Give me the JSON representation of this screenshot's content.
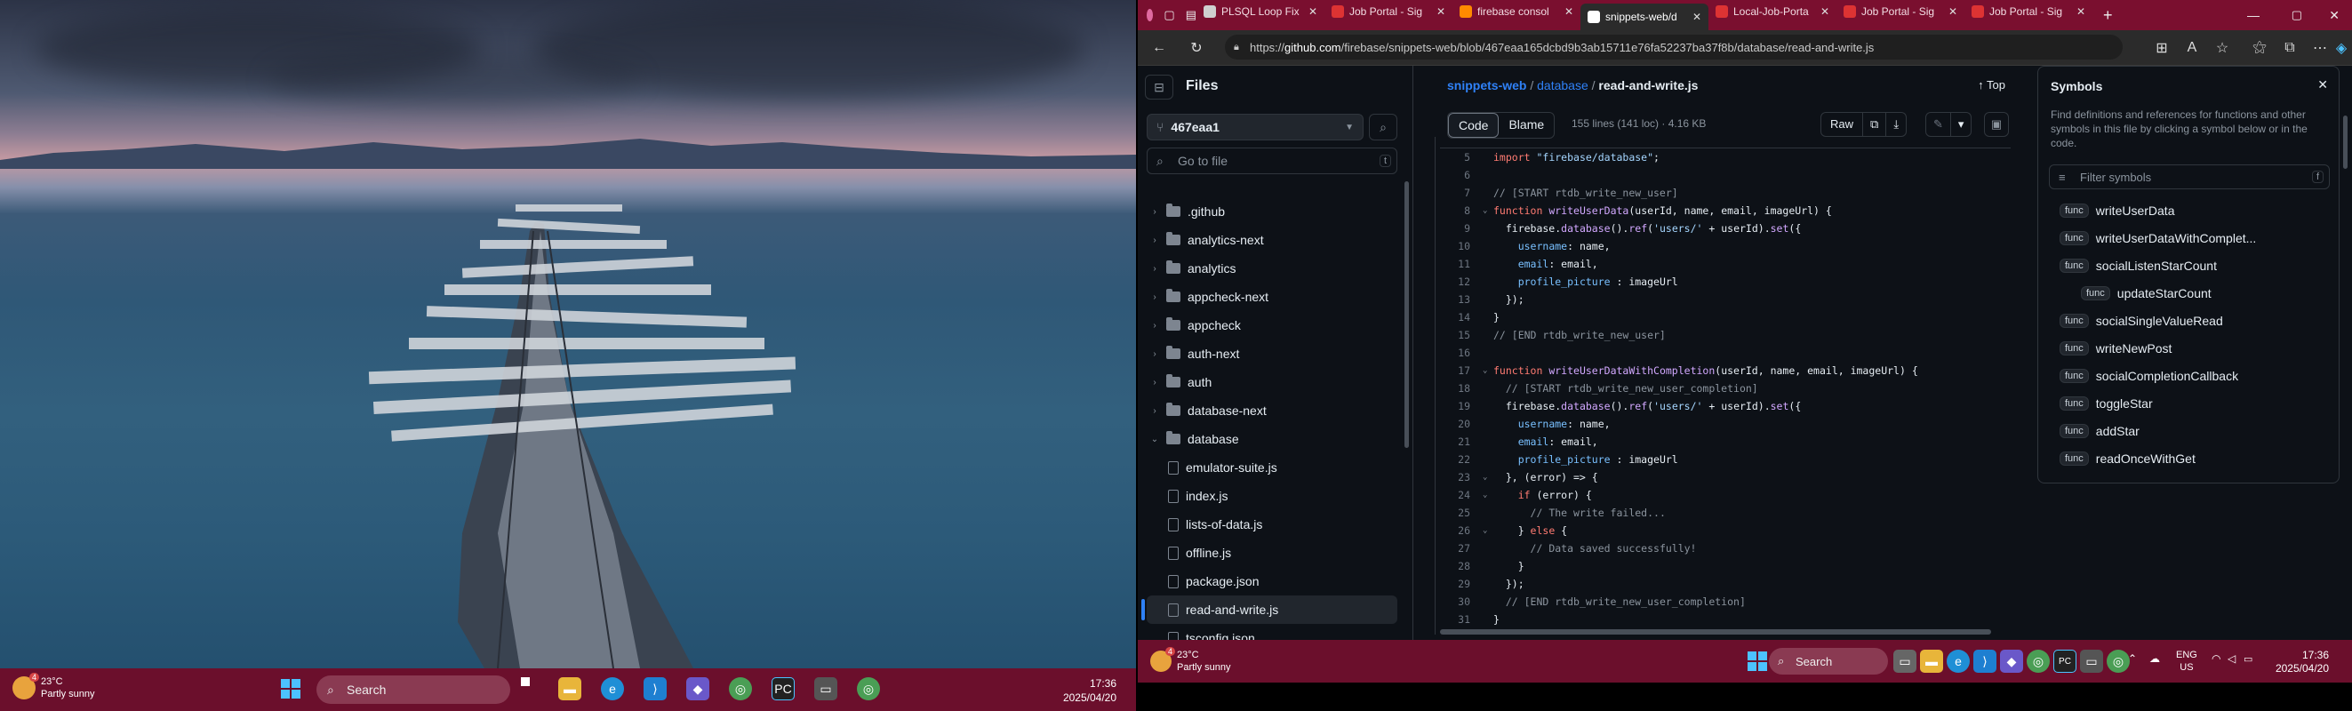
{
  "left_taskbar": {
    "weather_temp": "23°C",
    "weather_desc": "Partly sunny",
    "weather_badge": "4",
    "search": "Search",
    "time": "17:36",
    "date": "2025/04/20"
  },
  "browser": {
    "tabs": [
      {
        "label": "PLSQL Loop Fix",
        "fav": "#cfcfcf"
      },
      {
        "label": "Job Portal - Sig",
        "fav": "#d33"
      },
      {
        "label": "firebase consol",
        "fav": "#ff8a00"
      },
      {
        "label": "snippets-web/d",
        "fav": "#ffffff"
      },
      {
        "label": "Local-Job-Porta",
        "fav": "#d33"
      },
      {
        "label": "Job Portal - Sig",
        "fav": "#d33"
      },
      {
        "label": "Job Portal - Sig",
        "fav": "#d33"
      }
    ],
    "url_prefix": "https://",
    "url_host": "github.com",
    "url_path": "/firebase/snippets-web/blob/467eaa165dcbd9b3ab15711e76fa52237ba37f8b/database/read-and-write.js"
  },
  "files": {
    "title": "Files",
    "branch": "467eaa1",
    "goto_placeholder": "Go to file",
    "goto_key": "t",
    "items": [
      {
        "label": ".github",
        "kind": "folder",
        "open": false
      },
      {
        "label": "analytics-next",
        "kind": "folder",
        "open": false
      },
      {
        "label": "analytics",
        "kind": "folder",
        "open": false
      },
      {
        "label": "appcheck-next",
        "kind": "folder",
        "open": false
      },
      {
        "label": "appcheck",
        "kind": "folder",
        "open": false
      },
      {
        "label": "auth-next",
        "kind": "folder",
        "open": false
      },
      {
        "label": "auth",
        "kind": "folder",
        "open": false
      },
      {
        "label": "database-next",
        "kind": "folder",
        "open": false
      },
      {
        "label": "database",
        "kind": "folder",
        "open": true
      },
      {
        "label": "emulator-suite.js",
        "kind": "file"
      },
      {
        "label": "index.js",
        "kind": "file"
      },
      {
        "label": "lists-of-data.js",
        "kind": "file"
      },
      {
        "label": "offline.js",
        "kind": "file"
      },
      {
        "label": "package.json",
        "kind": "file"
      },
      {
        "label": "read-and-write.js",
        "kind": "file",
        "selected": true
      },
      {
        "label": "tsconfig.json",
        "kind": "file"
      }
    ]
  },
  "code": {
    "repo": "snippets-web",
    "dir": "database",
    "file": "read-and-write.js",
    "top": "Top",
    "tab_code": "Code",
    "tab_blame": "Blame",
    "meta": "155 lines (141 loc) · 4.16 KB",
    "raw": "Raw",
    "lines": [
      {
        "n": "5",
        "html": "<span class='kw'>import</span> <span class='st'>\"firebase/database\"</span>;"
      },
      {
        "n": "6",
        "html": ""
      },
      {
        "n": "7",
        "html": "<span class='cm'>// [START rtdb_write_new_user]</span>"
      },
      {
        "n": "8",
        "g": "⌄",
        "html": "<span class='kw'>function</span> <span class='fn'>writeUserData</span>(userId, name, email, imageUrl) {"
      },
      {
        "n": "9",
        "html": "  firebase.<span class='fn'>database</span>().<span class='fn'>ref</span>(<span class='st'>'users/'</span> + userId).<span class='fn'>set</span>({"
      },
      {
        "n": "10",
        "html": "    <span class='pr'>username</span>: name,"
      },
      {
        "n": "11",
        "html": "    <span class='pr'>email</span>: email,"
      },
      {
        "n": "12",
        "html": "    <span class='pr'>profile_picture</span> : imageUrl"
      },
      {
        "n": "13",
        "html": "  });"
      },
      {
        "n": "14",
        "html": "}"
      },
      {
        "n": "15",
        "html": "<span class='cm'>// [END rtdb_write_new_user]</span>"
      },
      {
        "n": "16",
        "html": ""
      },
      {
        "n": "17",
        "g": "⌄",
        "html": "<span class='kw'>function</span> <span class='fn'>writeUserDataWithCompletion</span>(userId, name, email, imageUrl) {"
      },
      {
        "n": "18",
        "html": "  <span class='cm'>// [START rtdb_write_new_user_completion]</span>"
      },
      {
        "n": "19",
        "html": "  firebase.<span class='fn'>database</span>().<span class='fn'>ref</span>(<span class='st'>'users/'</span> + userId).<span class='fn'>set</span>({"
      },
      {
        "n": "20",
        "html": "    <span class='pr'>username</span>: name,"
      },
      {
        "n": "21",
        "html": "    <span class='pr'>email</span>: email,"
      },
      {
        "n": "22",
        "html": "    <span class='pr'>profile_picture</span> : imageUrl"
      },
      {
        "n": "23",
        "g": "⌄",
        "html": "  }, (error) => {"
      },
      {
        "n": "24",
        "g": "⌄",
        "html": "    <span class='kw'>if</span> (error) {"
      },
      {
        "n": "25",
        "html": "      <span class='cm'>// The write failed...</span>"
      },
      {
        "n": "26",
        "g": "⌄",
        "html": "    } <span class='kw'>else</span> {"
      },
      {
        "n": "27",
        "html": "      <span class='cm'>// Data saved successfully!</span>"
      },
      {
        "n": "28",
        "html": "    }"
      },
      {
        "n": "29",
        "html": "  });"
      },
      {
        "n": "30",
        "html": "  <span class='cm'>// [END rtdb_write_new_user_completion]</span>"
      },
      {
        "n": "31",
        "html": "}"
      }
    ]
  },
  "symbols": {
    "title": "Symbols",
    "desc": "Find definitions and references for functions and other symbols in this file by clicking a symbol below or in the code.",
    "filter_placeholder": "Filter symbols",
    "filter_key": "f",
    "items": [
      {
        "label": "writeUserData",
        "indent": 0
      },
      {
        "label": "writeUserDataWithComplet...",
        "indent": 0
      },
      {
        "label": "socialListenStarCount",
        "indent": 0,
        "expand": true
      },
      {
        "label": "updateStarCount",
        "indent": 1
      },
      {
        "label": "socialSingleValueRead",
        "indent": 0
      },
      {
        "label": "writeNewPost",
        "indent": 0
      },
      {
        "label": "socialCompletionCallback",
        "indent": 0
      },
      {
        "label": "toggleStar",
        "indent": 0
      },
      {
        "label": "addStar",
        "indent": 0
      },
      {
        "label": "readOnceWithGet",
        "indent": 0
      }
    ],
    "badge": "func"
  },
  "right_taskbar": {
    "weather_temp": "23°C",
    "weather_desc": "Partly sunny",
    "weather_badge": "4",
    "search": "Search",
    "lang1": "ENG",
    "lang2": "US",
    "time": "17:36",
    "date": "2025/04/20"
  }
}
